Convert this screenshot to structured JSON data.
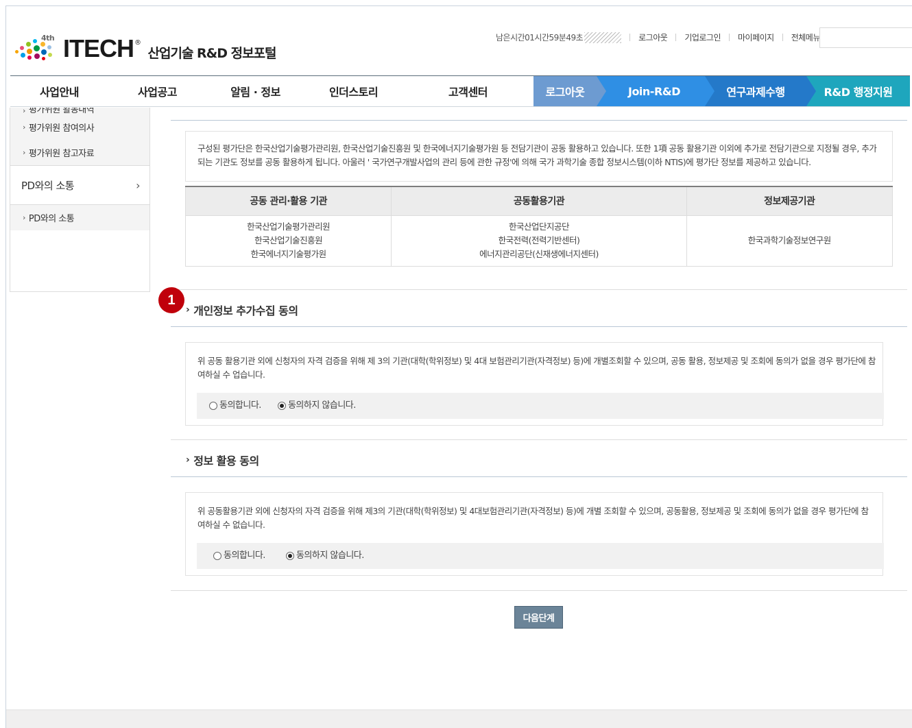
{
  "header": {
    "logo_badge": "4th",
    "logo_text": "ITECH",
    "logo_reg": "®",
    "logo_sub": "산업기술 R&D 정보포털",
    "timer": "남은시간01시간59분49초",
    "links": [
      "로그아웃",
      "기업로그인",
      "마이페이지",
      "전체메뉴"
    ]
  },
  "gnb": {
    "menus": [
      "사업안내",
      "사업공고",
      "알림 · 정보",
      "인더스토리",
      "고객센터"
    ],
    "blue_menus": [
      "로그아웃",
      "Join-R&D",
      "연구과제수행",
      "R&D 행정지원"
    ]
  },
  "sidebar": {
    "sub_items_top": [
      "평가위원 활동내역",
      "평가위원 참여의사",
      "평가위원 참고자료"
    ],
    "main_item": "PD와의 소통",
    "main_chev": "›",
    "sub_items_bottom": [
      "PD와의 소통"
    ],
    "bullet": "›"
  },
  "intro": {
    "text": "구성된 평가단은 한국산업기술평가관리원, 한국산업기술진흥원 및 한국에너지기술평가원 등 전담기관이 공동 활용하고 있습니다. 또한 1項 공동 활용기관 이외에 추가로 전담기관으로 지정될 경우, 추가되는 기관도 정보를 공동 활용하게 됩니다. 아울러 ' 국가연구개발사업의 관리 등에 관한 규정'에 의해 국가 과학기술 종합 정보시스템(이하 NTIS)에 평가단 정보를 제공하고 있습니다."
  },
  "org_table": {
    "headers": [
      "공동 관리·활용 기관",
      "공동활용기관",
      "정보제공기관"
    ],
    "col1": [
      "한국산업기술평가관리원",
      "한국산업기술진흥원",
      "한국에너지기술평가원"
    ],
    "col2": [
      "한국산업단지공단",
      "한국전력(전력기반센터)",
      "에너지관리공단(신재생에너지센터)"
    ],
    "col3": [
      "한국과학기술정보연구원"
    ]
  },
  "badge": "1",
  "section1": {
    "title": "개인정보 추가수집 동의",
    "text": "위 공동 활용기관 외에 신청자의 자격 검증을 위해 제 3의 기관(대학(학위정보) 및 4대 보험관리기관(자격정보) 등)에 개별조회할 수 있으며, 공동 활용, 정보제공 및 조회에 동의가 없을 경우 평가단에 참여하실 수 업습니다.",
    "agree": "동의합니다.",
    "disagree": "동의하지 않습니다.",
    "selected": "disagree"
  },
  "section2": {
    "title": "정보 활용 동의",
    "text": "위 공동활용기관 외에 신청자의 자격 검증을 위해 제3의 기관(대학(학위정보) 및 4대보험관리기관(자격정보) 등)에 개별 조회할 수 있으며, 공동활용, 정보제공 및 조회에 동의가 없을 경우 평가단에 참여하실 수 없습니다.",
    "agree": "동의합니다.",
    "disagree": "동의하지 않습니다.",
    "selected": "disagree"
  },
  "next_button": "다음단계",
  "title_bullet": "›",
  "colors": {
    "badge": "#c0000b",
    "gnb_blue1": "#6d9bd1",
    "gnb_blue2": "#2f8fe4",
    "gnb_blue3": "#2479c9",
    "gnb_teal": "#1ea6bd",
    "button": "#6b8498"
  }
}
